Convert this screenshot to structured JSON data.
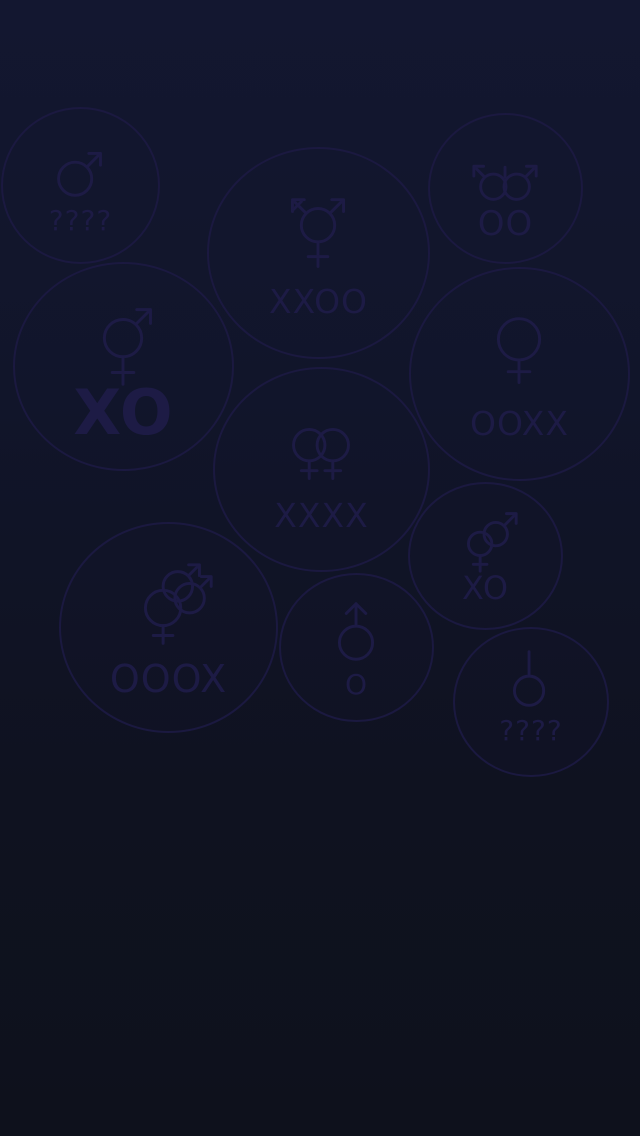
{
  "colors": {
    "background_top": "#131730",
    "background_bottom": "#0e111c",
    "bubble_outline": "#1b1940",
    "glyph": "#1d1b45"
  },
  "bubbles": [
    {
      "icon": "male-symbol-icon",
      "code": "????"
    },
    {
      "icon": "transgender-symbol-icon",
      "code": "XXOO"
    },
    {
      "icon": "double-transgender-symbol-icon",
      "code": "OO"
    },
    {
      "icon": "androgyne-symbol-icon",
      "code": "XO"
    },
    {
      "icon": "female-symbol-icon",
      "code": "OOXX"
    },
    {
      "icon": "double-female-symbol-icon",
      "code": "XXXX"
    },
    {
      "icon": "androgyne-pair-symbol-icon",
      "code": "XO"
    },
    {
      "icon": "multi-gender-symbol-icon",
      "code": "OOOX"
    },
    {
      "icon": "arrowed-circle-symbol-icon",
      "code": "O"
    },
    {
      "icon": "neutrois-symbol-icon",
      "code": "????"
    }
  ]
}
